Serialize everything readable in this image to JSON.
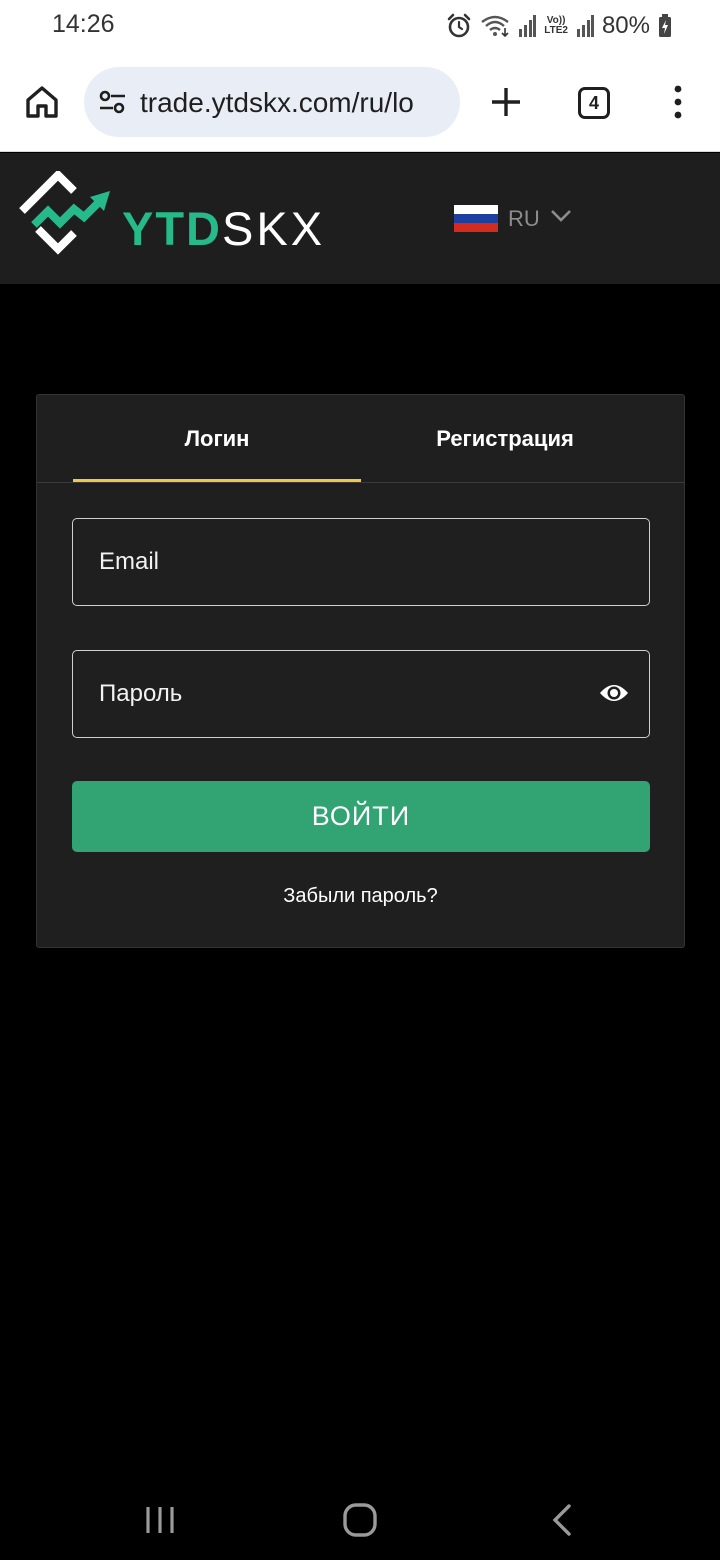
{
  "status_bar": {
    "time": "14:26",
    "lte_label_top": "Vo))",
    "lte_label_bottom": "LTE2",
    "battery": "80%",
    "icons": [
      "alarm-icon",
      "wifi-icon",
      "signal-icon",
      "signal-icon",
      "battery-charging-icon"
    ]
  },
  "browser": {
    "url": "trade.ytdskx.com/ru/lo",
    "tab_count": "4",
    "icons": [
      "home-icon",
      "site-settings-icon",
      "plus-icon",
      "more-vert-icon"
    ]
  },
  "header": {
    "logo_part1": "YTD",
    "logo_part2": "SKX",
    "language_code": "RU",
    "colors": {
      "brand_green": "#26b98a",
      "header_bg": "#1e1e1e"
    }
  },
  "login_card": {
    "tab_login": "Логин",
    "tab_register": "Регистрация",
    "email_placeholder": "Email",
    "password_placeholder": "Пароль",
    "submit_label": "ВОЙТИ",
    "forgot_password": "Забыли пароль?",
    "colors": {
      "active_tab_underline": "#f0c94a",
      "submit_bg": "#32a373"
    }
  },
  "nav_bar": {
    "icons": [
      "recents-icon",
      "home-circle-icon",
      "back-icon"
    ]
  }
}
